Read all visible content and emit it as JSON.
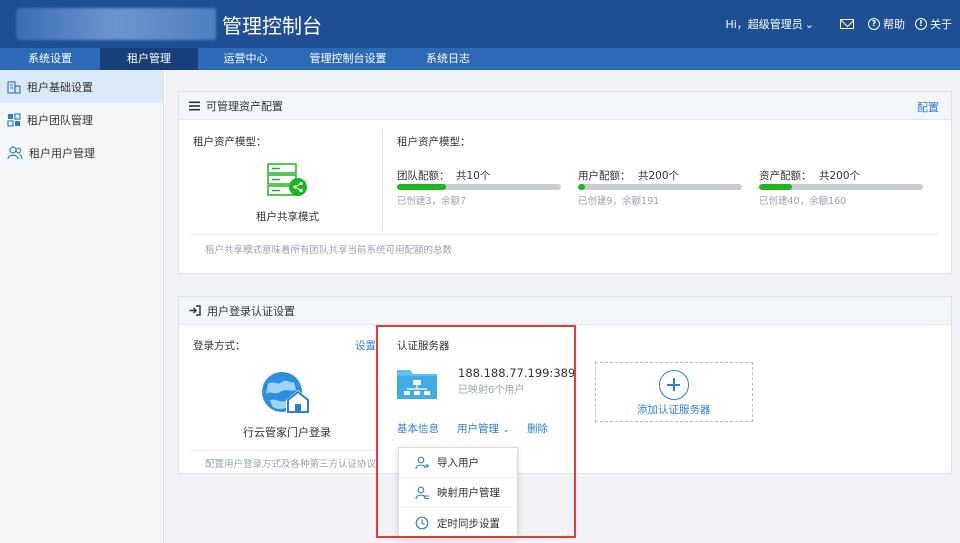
{
  "header": {
    "title": "管理控制台",
    "greeting": "Hi，超级管理员",
    "help": "帮助",
    "about": "关于"
  },
  "nav": {
    "items": [
      {
        "label": "系统设置",
        "active": false
      },
      {
        "label": "租户管理",
        "active": true
      },
      {
        "label": "运营中心",
        "active": false
      },
      {
        "label": "管理控制台设置",
        "active": false
      },
      {
        "label": "系统日志",
        "active": false
      }
    ]
  },
  "sidebar": {
    "items": [
      {
        "label": "租户基础设置",
        "active": true
      },
      {
        "label": "租户团队管理",
        "active": false
      },
      {
        "label": "租户用户管理",
        "active": false
      }
    ]
  },
  "asset_panel": {
    "title": "可管理资产配置",
    "config_link": "配置",
    "model_label_left": "租户资产模型：",
    "mode_name": "租户共享模式",
    "model_label_right": "租户资产模型：",
    "quotas": [
      {
        "name": "团队配额：",
        "total": "共10个",
        "detail": "已创建3，余额7",
        "fill": 0.3
      },
      {
        "name": "用户配额：",
        "total": "共200个",
        "detail": "已创建9，余额191",
        "fill": 0.045
      },
      {
        "name": "资产配额：",
        "total": "共200个",
        "detail": "已创建40，余额160",
        "fill": 0.2
      }
    ],
    "note": "租户共享模式意味着所有团队共享当前系统可用配额的总数"
  },
  "auth_panel": {
    "title": "用户登录认证设置",
    "login_label": "登录方式：",
    "set_link": "设置",
    "login_method": "行云管家门户登录",
    "server_section": "认证服务器",
    "server_ip": "188.188.77.199:389",
    "server_mapped": "已映射6个用户",
    "actions": {
      "basic": "基本信息",
      "user_mgmt": "用户管理",
      "delete": "删除"
    },
    "add_server": "添加认证服务器",
    "note": "配置用户登录方式及各种第三方认证协议"
  },
  "dropdown": {
    "items": [
      "导入用户",
      "映射用户管理",
      "定时同步设置"
    ]
  },
  "colors": {
    "header_bg": "#1e4f95",
    "nav_bg": "#2d6ab6",
    "nav_active": "#173f7a",
    "accent": "#2f7fd0",
    "progress": "#1fb521",
    "highlight": "#e53a3a"
  }
}
